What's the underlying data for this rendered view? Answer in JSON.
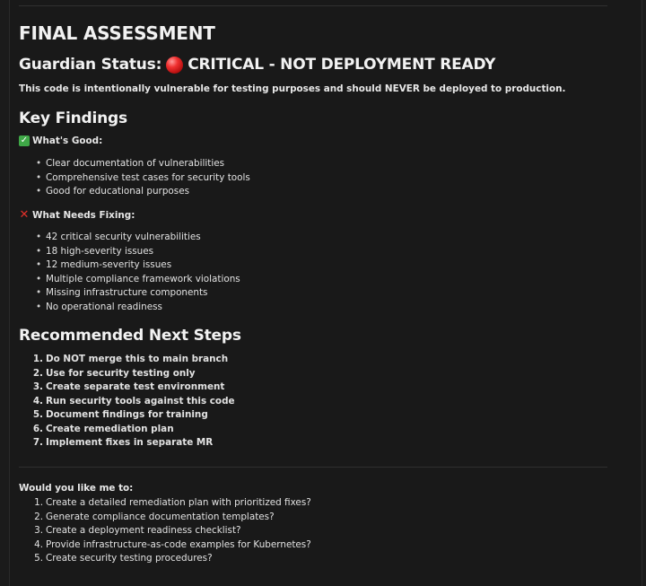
{
  "title": "FINAL ASSESSMENT",
  "status": {
    "label": "Guardian Status:",
    "icon": "red-circle-icon",
    "value": "CRITICAL - NOT DEPLOYMENT READY"
  },
  "note": "This code is intentionally vulnerable for testing purposes and should NEVER be deployed to production.",
  "key_findings": {
    "heading": "Key Findings",
    "good": {
      "icon": "check-icon",
      "label": "What's Good:",
      "items": [
        "Clear documentation of vulnerabilities",
        "Comprehensive test cases for security tools",
        "Good for educational purposes"
      ]
    },
    "fix": {
      "icon": "cross-icon",
      "label": "What Needs Fixing:",
      "items": [
        "42 critical security vulnerabilities",
        "18 high-severity issues",
        "12 medium-severity issues",
        "Multiple compliance framework violations",
        "Missing infrastructure components",
        "No operational readiness"
      ]
    }
  },
  "next_steps": {
    "heading": "Recommended Next Steps",
    "items": [
      {
        "n": "1.",
        "text": "Do NOT merge this to main branch"
      },
      {
        "n": "2.",
        "text": "Use for security testing only"
      },
      {
        "n": "3.",
        "text": "Create separate test environment"
      },
      {
        "n": "4.",
        "text": "Run security tools against this code"
      },
      {
        "n": "5.",
        "text": "Document findings for training"
      },
      {
        "n": "6.",
        "text": "Create remediation plan"
      },
      {
        "n": "7.",
        "text": "Implement fixes in separate MR"
      }
    ]
  },
  "followup": {
    "prompt": "Would you like me to:",
    "items": [
      {
        "n": "1.",
        "text": "Create a detailed remediation plan with prioritized fixes?"
      },
      {
        "n": "2.",
        "text": "Generate compliance documentation templates?"
      },
      {
        "n": "3.",
        "text": "Create a deployment readiness checklist?"
      },
      {
        "n": "4.",
        "text": "Provide infrastructure-as-code examples for Kubernetes?"
      },
      {
        "n": "5.",
        "text": "Create security testing procedures?"
      }
    ]
  },
  "colors": {
    "background": "#191919",
    "text": "#e6e6e6",
    "critical": "#e0302a",
    "good": "#3fa847"
  }
}
